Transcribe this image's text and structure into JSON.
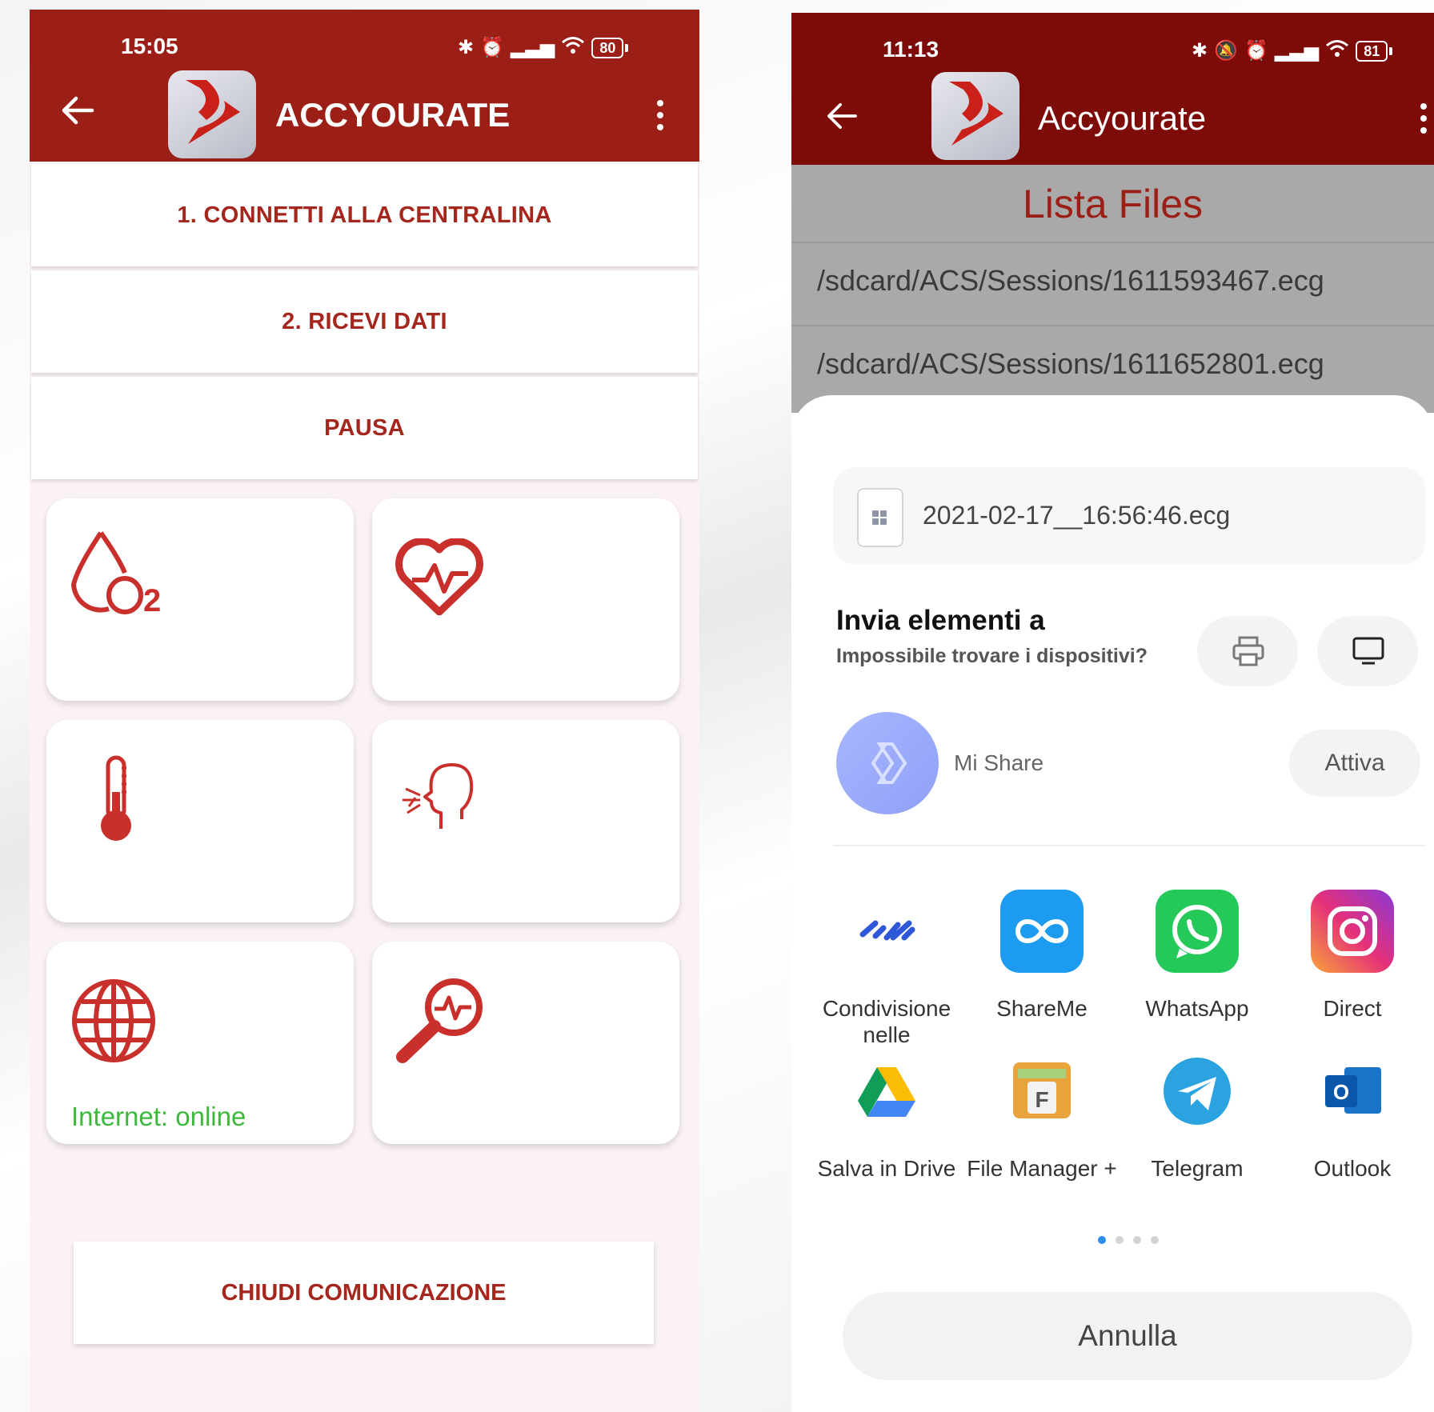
{
  "left": {
    "status": {
      "time": "15:05",
      "battery": "80"
    },
    "app_title": "ACCYOURATE",
    "buttons": {
      "connect": "1. CONNETTI ALLA CENTRALINA",
      "receive": "2. RICEVI DATI",
      "pause": "PAUSA",
      "close": "CHIUDI COMUNICAZIONE"
    },
    "tiles": [
      {
        "icon": "oxygen-drop-icon"
      },
      {
        "icon": "heart-pulse-icon"
      },
      {
        "icon": "thermometer-icon"
      },
      {
        "icon": "breathing-head-icon"
      },
      {
        "icon": "globe-icon",
        "status": "Internet: online"
      },
      {
        "icon": "magnifier-ecg-icon"
      }
    ],
    "colors": {
      "primary": "#9b1f16",
      "accent_text": "#a4261c",
      "online": "#3cb93c"
    }
  },
  "right": {
    "status": {
      "time": "11:13",
      "battery": "81"
    },
    "app_title": "Accyourate",
    "list_title": "Lista Files",
    "files": [
      "/sdcard/ACS/Sessions/1611593467.ecg",
      "/sdcard/ACS/Sessions/1611652801.ecg"
    ],
    "share_sheet": {
      "file_name": "2021-02-17__16:56:46.ecg",
      "send_title": "Invia elementi a",
      "send_subtitle": "Impossibile trovare i dispositivi?",
      "mishare_label": "Mi Share",
      "attiva_label": "Attiva",
      "apps": [
        {
          "label": "Condivisione nelle",
          "icon": "nearby-share-icon"
        },
        {
          "label": "ShareMe",
          "icon": "shareme-icon"
        },
        {
          "label": "WhatsApp",
          "icon": "whatsapp-icon"
        },
        {
          "label": "Direct",
          "icon": "instagram-icon"
        },
        {
          "label": "Salva in Drive",
          "icon": "google-drive-icon"
        },
        {
          "label": "File Manager +",
          "icon": "file-manager-icon"
        },
        {
          "label": "Telegram",
          "icon": "telegram-icon"
        },
        {
          "label": "Outlook",
          "icon": "outlook-icon"
        }
      ],
      "page_indicator": {
        "current": 1,
        "total": 4
      },
      "cancel_label": "Annulla"
    }
  }
}
